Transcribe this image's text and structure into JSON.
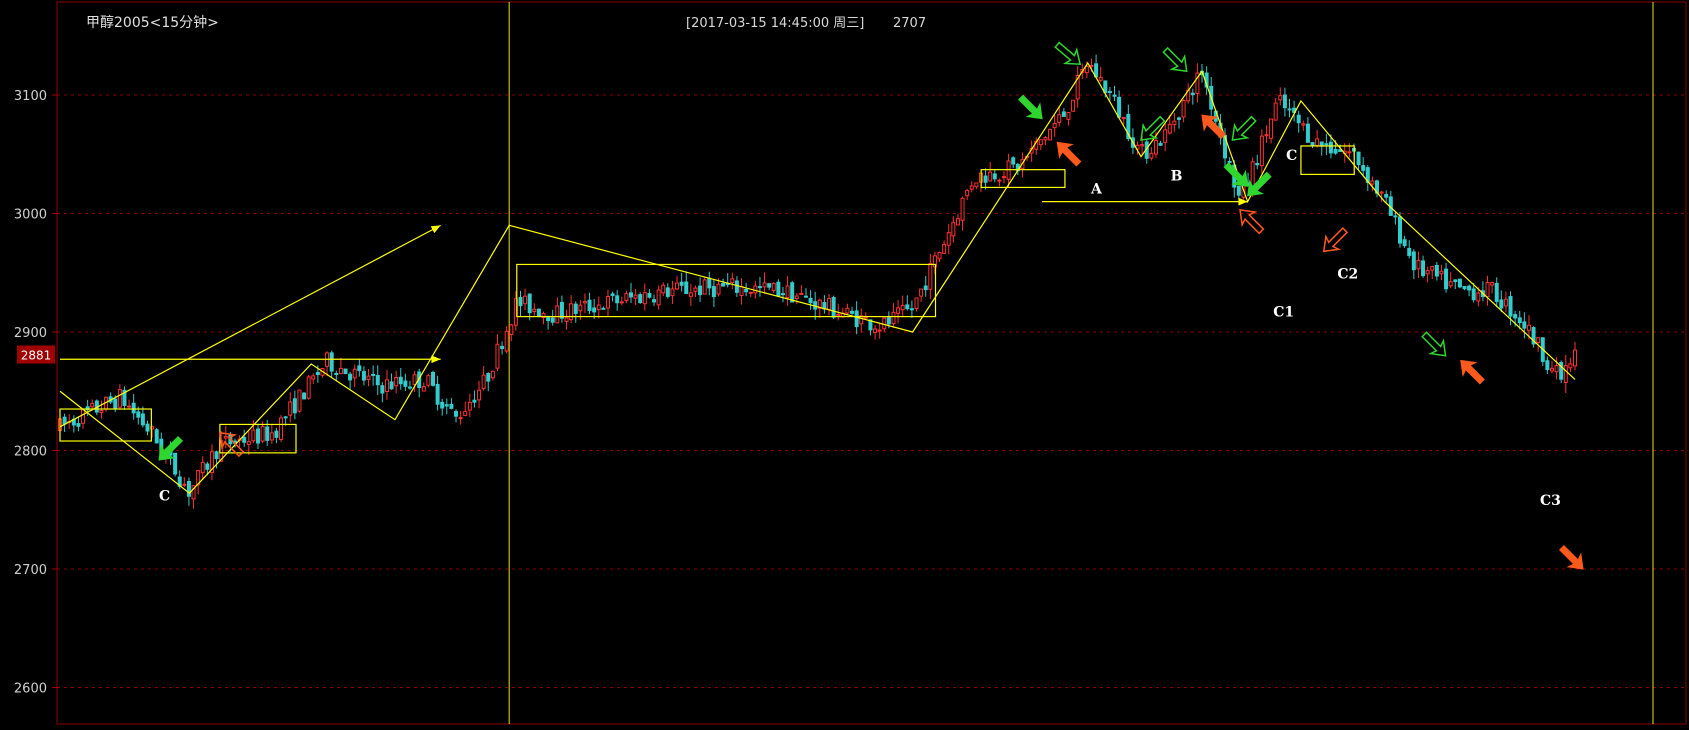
{
  "header": {
    "symbol": "甲醇2005<15分钟>",
    "cursor_info": "[2017-03-15  14:45:00 周三]",
    "cursor_value": "2707"
  },
  "current_price": "2881",
  "colors": {
    "background": "#000000",
    "up_candle": "#ff3030",
    "down_candle": "#33cccc",
    "trend_lines": "#ffff00",
    "grid": "#8b0000",
    "price_badge": "#a00000",
    "arrow_up": "#ff5a1e",
    "arrow_down": "#2ed62e",
    "annotation_text": "#ffffff"
  },
  "chart_data": {
    "type": "candlestick",
    "ylim": [
      2570,
      3180
    ],
    "y_ticks": [
      "3100",
      "3000",
      "2900",
      "2800",
      "2700",
      "2600"
    ],
    "x_count": 200,
    "grid": "horizontal dashed",
    "key_points": [
      {
        "x": 0,
        "y": 2820
      },
      {
        "x": 8,
        "y": 2845
      },
      {
        "x": 12,
        "y": 2815
      },
      {
        "x": 17,
        "y": 2765
      },
      {
        "x": 21,
        "y": 2805
      },
      {
        "x": 28,
        "y": 2815
      },
      {
        "x": 35,
        "y": 2875
      },
      {
        "x": 42,
        "y": 2855
      },
      {
        "x": 48,
        "y": 2860
      },
      {
        "x": 52,
        "y": 2827
      },
      {
        "x": 56,
        "y": 2860
      },
      {
        "x": 60,
        "y": 2925
      },
      {
        "x": 65,
        "y": 2915
      },
      {
        "x": 72,
        "y": 2925
      },
      {
        "x": 80,
        "y": 2935
      },
      {
        "x": 88,
        "y": 2938
      },
      {
        "x": 95,
        "y": 2935
      },
      {
        "x": 102,
        "y": 2918
      },
      {
        "x": 108,
        "y": 2905
      },
      {
        "x": 112,
        "y": 2920
      },
      {
        "x": 116,
        "y": 2975
      },
      {
        "x": 120,
        "y": 3030
      },
      {
        "x": 126,
        "y": 3040
      },
      {
        "x": 132,
        "y": 3085
      },
      {
        "x": 135,
        "y": 3128
      },
      {
        "x": 138,
        "y": 3100
      },
      {
        "x": 142,
        "y": 3050
      },
      {
        "x": 145,
        "y": 3065
      },
      {
        "x": 150,
        "y": 3120
      },
      {
        "x": 155,
        "y": 3010
      },
      {
        "x": 160,
        "y": 3095
      },
      {
        "x": 165,
        "y": 3060
      },
      {
        "x": 170,
        "y": 3050
      },
      {
        "x": 174,
        "y": 3010
      },
      {
        "x": 178,
        "y": 2955
      },
      {
        "x": 184,
        "y": 2935
      },
      {
        "x": 188,
        "y": 2935
      },
      {
        "x": 192,
        "y": 2910
      },
      {
        "x": 197,
        "y": 2860
      },
      {
        "x": 199,
        "y": 2880
      }
    ],
    "zigzag": [
      {
        "x": 0,
        "y": 2850
      },
      {
        "x": 17,
        "y": 2764
      },
      {
        "x": 33,
        "y": 2873
      },
      {
        "x": 44,
        "y": 2826
      },
      {
        "x": 59,
        "y": 2990
      },
      {
        "x": 112,
        "y": 2900
      },
      {
        "x": 135,
        "y": 3127
      },
      {
        "x": 142,
        "y": 3048
      },
      {
        "x": 150,
        "y": 3120
      },
      {
        "x": 156,
        "y": 3010
      },
      {
        "x": 163,
        "y": 3095
      },
      {
        "x": 174,
        "y": 3010
      },
      {
        "x": 199,
        "y": 2860
      }
    ],
    "boxes": [
      {
        "x1": 0,
        "x2": 12,
        "y1": 2808,
        "y2": 2835
      },
      {
        "x1": 21,
        "x2": 31,
        "y1": 2798,
        "y2": 2822
      },
      {
        "x1": 60,
        "x2": 115,
        "y1": 2913,
        "y2": 2957
      },
      {
        "x1": 121,
        "x2": 132,
        "y1": 3022,
        "y2": 3037
      },
      {
        "x1": 163,
        "x2": 170,
        "y1": 3033,
        "y2": 3057
      }
    ],
    "annotations": [
      "C",
      "A",
      "B",
      "C",
      "C1",
      "C2",
      "C3"
    ]
  }
}
